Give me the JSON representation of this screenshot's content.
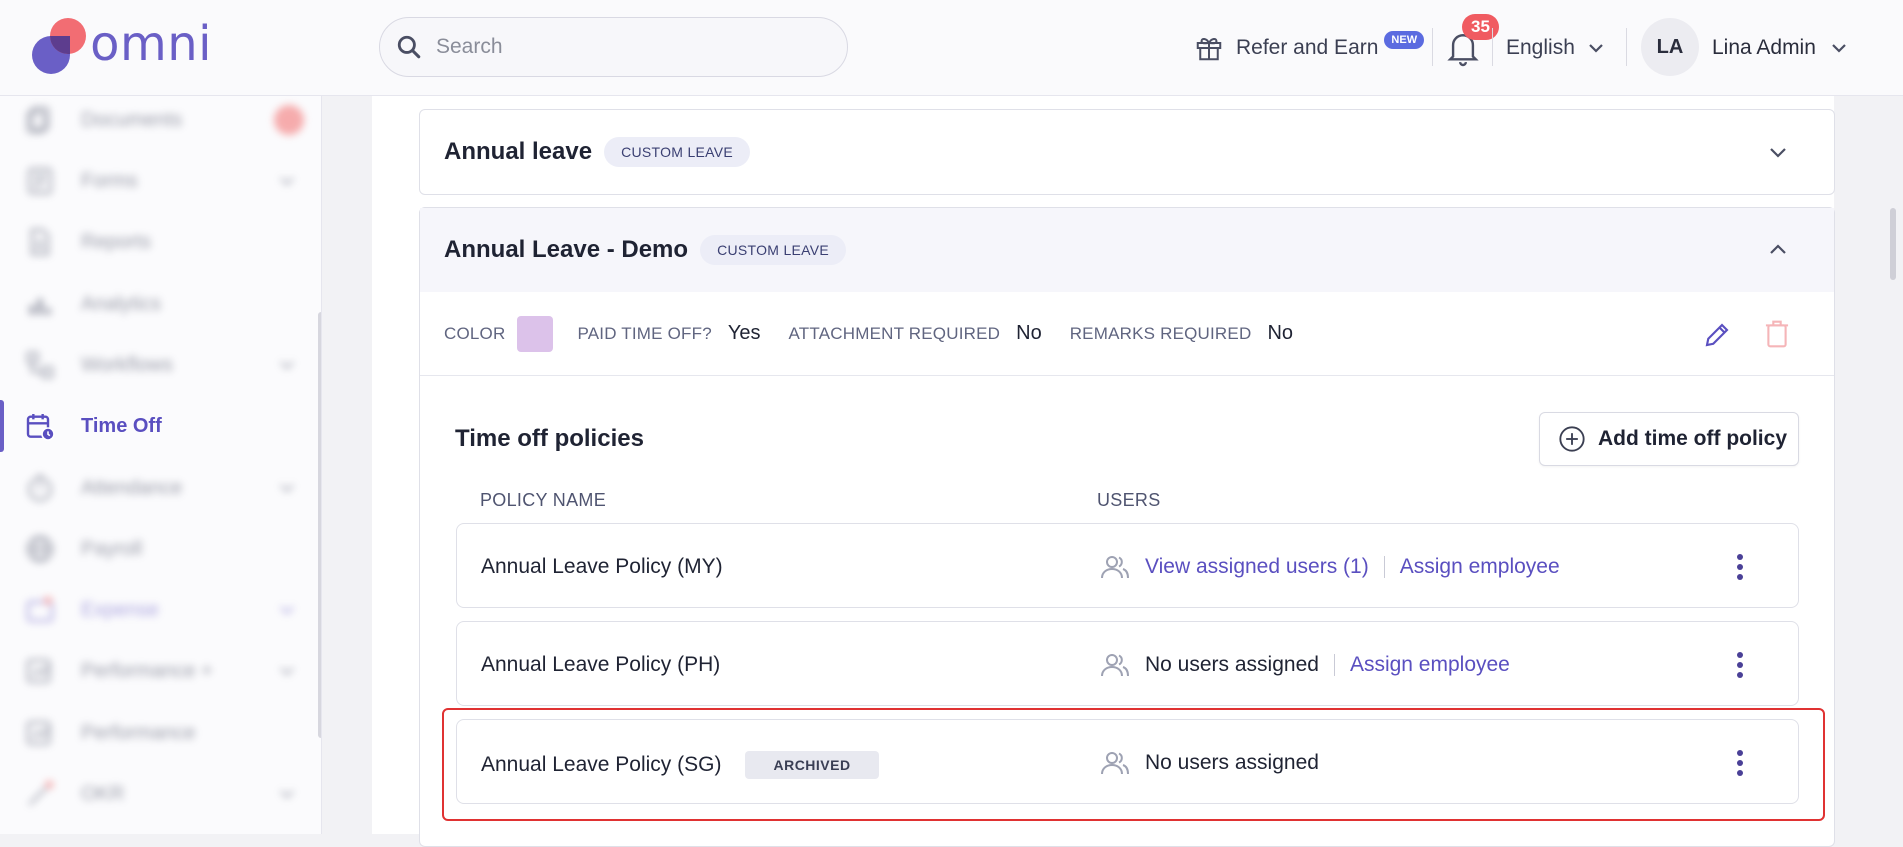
{
  "header": {
    "logo_text": "omni",
    "search_placeholder": "Search",
    "refer_label": "Refer and Earn",
    "new_badge": "NEW",
    "notification_count": "35",
    "language": "English",
    "avatar_initials": "LA",
    "user_name": "Lina Admin"
  },
  "sidebar": {
    "items": [
      {
        "label": "Documents",
        "blurred": true
      },
      {
        "label": "Forms",
        "blurred": true
      },
      {
        "label": "Reports",
        "blurred": true
      },
      {
        "label": "Analytics",
        "blurred": true
      },
      {
        "label": "Workflows",
        "blurred": true
      },
      {
        "label": "Time Off",
        "blurred": false
      },
      {
        "label": "Attendance",
        "blurred": true
      },
      {
        "label": "Payroll",
        "blurred": true
      },
      {
        "label": "Expense",
        "blurred": true
      },
      {
        "label": "Performance +",
        "blurred": true
      },
      {
        "label": "Performance",
        "blurred": true
      },
      {
        "label": "OKR",
        "blurred": true
      }
    ]
  },
  "leave_types": [
    {
      "title": "Annual leave",
      "tag": "CUSTOM LEAVE",
      "expanded": false
    },
    {
      "title": "Annual Leave - Demo",
      "tag": "CUSTOM LEAVE",
      "expanded": true
    }
  ],
  "props": {
    "color_label": "COLOR",
    "color_value": "#dcc2ea",
    "paid_label": "PAID TIME OFF?",
    "paid_value": "Yes",
    "attachment_label": "ATTACHMENT REQUIRED",
    "attachment_value": "No",
    "remarks_label": "REMARKS REQUIRED",
    "remarks_value": "No"
  },
  "policies": {
    "title": "Time off policies",
    "add_button": "Add time off policy",
    "col_policy": "POLICY NAME",
    "col_users": "USERS",
    "rows": [
      {
        "name": "Annual Leave Policy (MY)",
        "tag": "",
        "users": "View assigned users (1)",
        "assign": "Assign employee"
      },
      {
        "name": "Annual Leave Policy (PH)",
        "tag": "",
        "users": "No users assigned",
        "assign": "Assign employee"
      },
      {
        "name": "Annual Leave Policy (SG)",
        "tag": "ARCHIVED",
        "users": "No users assigned",
        "assign": ""
      }
    ]
  },
  "colors": {
    "brand": "#6a5fc6",
    "accent_red": "#f05b61",
    "highlight": "#e03232"
  }
}
